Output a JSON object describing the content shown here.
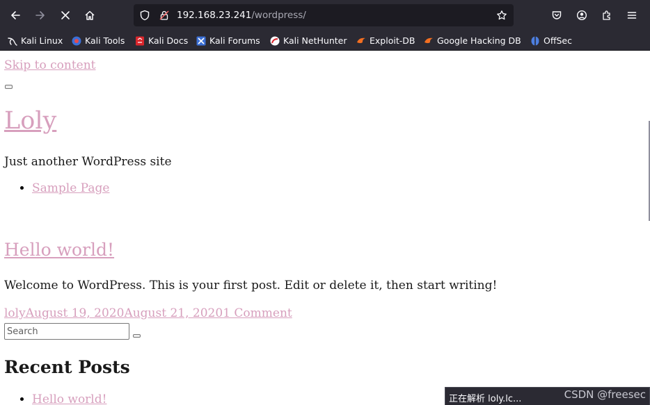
{
  "browser": {
    "url_host": "192.168.23.241",
    "url_path": "/wordpress/",
    "bookmarks": [
      {
        "label": "Kali Linux",
        "icon": "kali-dragon-icon"
      },
      {
        "label": "Kali Tools",
        "icon": "kali-tools-icon"
      },
      {
        "label": "Kali Docs",
        "icon": "kali-docs-icon"
      },
      {
        "label": "Kali Forums",
        "icon": "kali-forums-icon"
      },
      {
        "label": "Kali NetHunter",
        "icon": "kali-nethunter-icon"
      },
      {
        "label": "Exploit-DB",
        "icon": "exploit-db-icon"
      },
      {
        "label": "Google Hacking DB",
        "icon": "ghdb-icon"
      },
      {
        "label": "OffSec",
        "icon": "offsec-icon"
      }
    ],
    "colors": {
      "chrome_bg": "#2b2a33",
      "urlbar_bg": "#1c1b22",
      "link": "#d79fbd"
    }
  },
  "page": {
    "skip_link": "Skip to content",
    "site_title": "Loly",
    "tagline": "Just another WordPress site",
    "nav": [
      {
        "label": "Sample Page"
      }
    ],
    "post": {
      "title": "Hello world!",
      "excerpt": "Welcome to WordPress. This is your first post. Edit or delete it, then start writing!",
      "author": "loly",
      "published": "August 19, 2020",
      "updated": "August 21, 2020",
      "comments": "1 Comment"
    },
    "search": {
      "placeholder": "Search"
    },
    "recent_posts_heading": "Recent Posts",
    "recent_posts": [
      {
        "label": "Hello world!"
      }
    ]
  },
  "status": {
    "text": "正在解析 loly.lc...",
    "watermark": "CSDN @freesec"
  }
}
